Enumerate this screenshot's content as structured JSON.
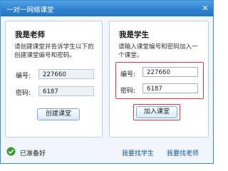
{
  "window": {
    "title": "一对一网络课堂",
    "close_glyph": "✕"
  },
  "teacher_panel": {
    "title": "我是老师",
    "description_line1": "请创建课堂并告诉学生以下的",
    "description_line2": "创建课堂编号和密码。",
    "id_label": "编号:",
    "id_value": "227660",
    "pwd_label": "密码:",
    "pwd_value": "6187",
    "create_button": "创建课堂"
  },
  "student_panel": {
    "title": "我是学生",
    "description_line1": "请输入课堂编号和密码加入一",
    "description_line2": "个课堂。",
    "id_label": "编号:",
    "id_value": "227660",
    "pwd_label": "密码:",
    "pwd_value": "6187",
    "join_button": "加入课堂"
  },
  "status_bar": {
    "status_text": "已准备好",
    "find_student_link": "我要找学生",
    "find_teacher_link": "我要找老师"
  },
  "colors": {
    "titlebar": "#2d7fcc",
    "highlight": "#d6393e",
    "link": "#1255a6",
    "ok_green": "#3a9d2a"
  }
}
